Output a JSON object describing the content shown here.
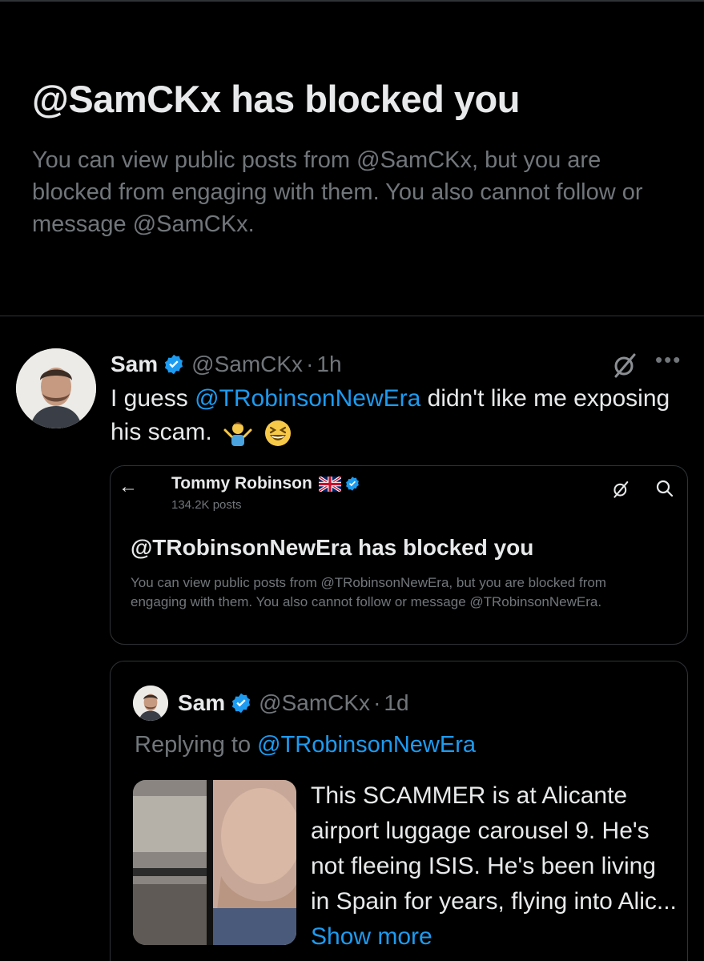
{
  "block_notice": {
    "title": "@SamCKx has blocked you",
    "description": "You can view public posts from @SamCKx, but you are blocked from engaging with them. You also cannot follow or message @SamCKx."
  },
  "post": {
    "author_name": "Sam",
    "author_handle": "@SamCKx",
    "separator": "·",
    "time": "1h",
    "text_before": "I guess ",
    "mention": "@TRobinsonNewEra",
    "text_after": " didn't like me exposing his scam.",
    "emojis": [
      "man-shrugging-emoji",
      "grinning-squinting-face-emoji"
    ]
  },
  "embedded_screenshot": {
    "back_icon": "←",
    "profile_name": "Tommy Robinson",
    "flag": "union-jack-flag",
    "posts_count": "134.2K posts",
    "title": "@TRobinsonNewEra has blocked you",
    "description": "You can view public posts from @TRobinsonNewEra, but you are blocked from engaging with them. You also cannot follow or message @TRobinsonNewEra."
  },
  "quoted_post": {
    "author_name": "Sam",
    "author_handle": "@SamCKx",
    "separator": "·",
    "time": "1d",
    "replying_prefix": "Replying to ",
    "replying_to": "@TRobinsonNewEra",
    "text": "This SCAMMER is at Alicante airport luggage carousel 9. He's not fleeing ISIS. He's been living in Spain for years, flying into Alic...",
    "show_more": "Show more"
  },
  "colors": {
    "background": "#000000",
    "primary_text": "#e7e9ea",
    "secondary_text": "#71767b",
    "accent": "#1d9bf0",
    "border": "#2f3336"
  }
}
